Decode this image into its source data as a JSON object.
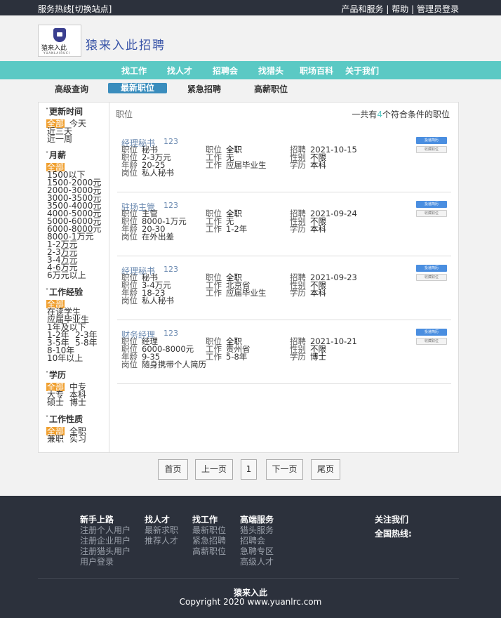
{
  "topbar": {
    "hotline": "服务热线[切换站点]",
    "products": "产品和服务",
    "sep1": "|",
    "help": "帮助",
    "sep2": "|",
    "admin": "管理员登录"
  },
  "logo": {
    "text_cn": "猿来入此",
    "text_en": "YUANLAIRUCI"
  },
  "site_name": "猿来入此招聘",
  "nav": [
    "找工作",
    "找人才",
    "招聘会",
    "找猎头",
    "职场百科",
    "关于我们"
  ],
  "subnav": [
    "高级查询",
    "最新职位",
    "紧急招聘",
    "高薪职位"
  ],
  "filters": {
    "update_time": {
      "title": "更新时间",
      "all": "全部",
      "options": [
        "今天",
        "近三天",
        "近一周"
      ]
    },
    "salary": {
      "title": "月薪",
      "all": "全部",
      "options": [
        "1500以下",
        "1500-2000元",
        "2000-3000元",
        "3000-3500元",
        "3500-4000元",
        "4000-5000元",
        "5000-6000元",
        "6000-8000元",
        "8000-1万元",
        "1-2万元",
        "2-3万元",
        "3-4万元",
        "4-6万元",
        "6万元以上"
      ]
    },
    "experience": {
      "title": "工作经验",
      "all": "全部",
      "options": [
        "在读学生",
        "应届毕业生",
        "1年及以下",
        "1-2年",
        "2-3年",
        "3-5年",
        "5-8年",
        "8-10年",
        "10年以上"
      ]
    },
    "education": {
      "title": "学历",
      "all": "全部",
      "options": [
        "中专",
        "大专",
        "本科",
        "硕士",
        "博士"
      ]
    },
    "nature": {
      "title": "工作性质",
      "all": "全部",
      "options": [
        "全职",
        "兼职",
        "实习"
      ]
    }
  },
  "content": {
    "header": "职位",
    "count_prefix": "一共有",
    "count": "4",
    "count_suffix": "个符合条件的职位"
  },
  "labels": {
    "position": "职位",
    "salary": "职位",
    "age": "年龄",
    "post": "岗位",
    "type": "职位",
    "work": "工作",
    "work2": "工作",
    "recruit": "招聘",
    "gender": "性别",
    "edu": "学历",
    "apply": "投递简历",
    "fav": "收藏职位"
  },
  "jobs": [
    {
      "title": "经理秘书",
      "num": "123",
      "position": "秘书",
      "salary": "2-3万元",
      "age": "20-25",
      "post": "私人秘书",
      "type": "全职",
      "work_place": "无",
      "work_exp": "应届毕业生",
      "date": "2021-10-15",
      "gender": "不限",
      "edu": "本科"
    },
    {
      "title": "驻场主管",
      "num": "123",
      "position": "主管",
      "salary": "8000-1万元",
      "age": "20-30",
      "post": "在外出差",
      "type": "全职",
      "work_place": "无",
      "work_exp": "1-2年",
      "date": "2021-09-24",
      "gender": "不限",
      "edu": "本科"
    },
    {
      "title": "经理秘书",
      "num": "123",
      "position": "秘书",
      "salary": "3-4万元",
      "age": "18-23",
      "post": "私人秘书",
      "type": "全职",
      "work_place": "北京省",
      "work_exp": "应届毕业生",
      "date": "2021-09-23",
      "gender": "不限",
      "edu": "本科"
    },
    {
      "title": "财务经理",
      "num": "123",
      "position": "经理",
      "salary": "6000-8000元",
      "age": "9-35",
      "post": "随身携带个人简历",
      "type": "全职",
      "work_place": "贵州省",
      "work_exp": "5-8年",
      "date": "2021-10-21",
      "gender": "不限",
      "edu": "博士"
    }
  ],
  "pager": {
    "first": "首页",
    "prev": "上一页",
    "current": "1",
    "next": "下一页",
    "last": "尾页"
  },
  "footer": {
    "cols": [
      {
        "title": "新手上路",
        "items": [
          "注册个人用户",
          "注册企业用户",
          "注册猎头用户",
          "用户登录"
        ]
      },
      {
        "title": "找人才",
        "items": [
          "最新求职",
          "推荐人才"
        ]
      },
      {
        "title": "找工作",
        "items": [
          "最新职位",
          "紧急招聘",
          "高薪职位"
        ]
      },
      {
        "title": "高端服务",
        "items": [
          "猎头服务",
          "招聘会",
          "急聘专区",
          "高级人才"
        ]
      }
    ],
    "follow": "关注我们",
    "hotline": "全国热线:",
    "brand": "猿来入此",
    "copyright": "Copyright 2020 www.yuanlrc.com"
  },
  "colors": {
    "accent": "#5bc9c4",
    "active_tab": "#3a8dbd",
    "selected": "#f0a030",
    "footer": "#2c313c"
  }
}
